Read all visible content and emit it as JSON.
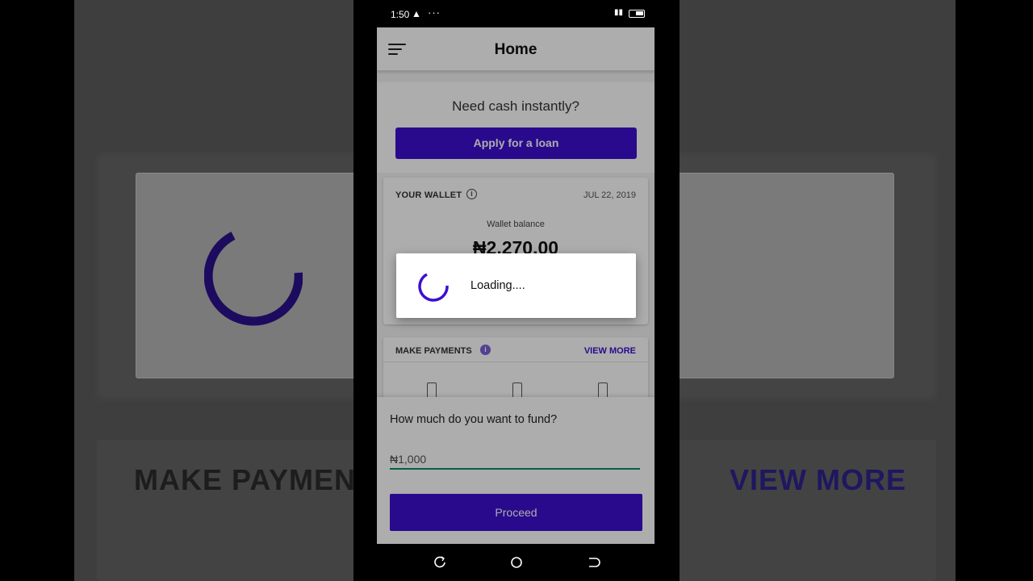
{
  "status_bar": {
    "time": "1:50",
    "warning_glyph": "▲",
    "more_glyph": "···",
    "signal_glyph": "▮▮"
  },
  "background_echo": {
    "make_payments": "MAKE PAYMENT",
    "view_more": "VIEW MORE"
  },
  "app_bar": {
    "title": "Home"
  },
  "promo": {
    "text": "Need cash instantly?",
    "button_label": "Apply for a loan"
  },
  "wallet": {
    "label": "YOUR WALLET",
    "info_glyph": "i",
    "date": "JUL 22, 2019",
    "balance_label": "Wallet balance",
    "balance": "₦2,270.00"
  },
  "payments": {
    "label": "MAKE PAYMENTS",
    "info_glyph": "i",
    "view_more": "VIEW MORE"
  },
  "fund_sheet": {
    "question": "How much do you want to fund?",
    "input_value": "₦1,000",
    "proceed_label": "Proceed"
  },
  "dialog": {
    "text": "Loading...."
  },
  "colors": {
    "primary": "#3d0fd0",
    "input_underline": "#0a8a6a"
  }
}
